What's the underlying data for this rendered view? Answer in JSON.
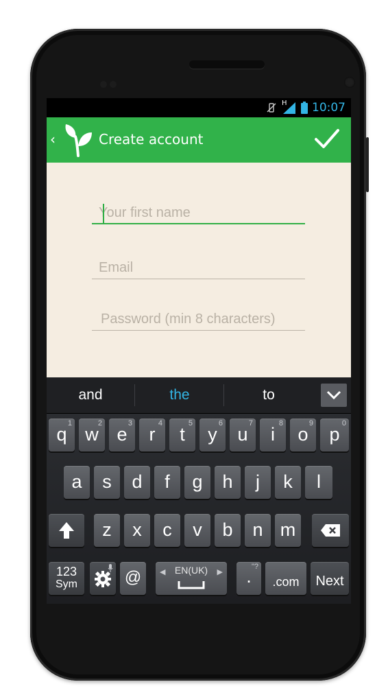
{
  "status_bar": {
    "time": "10:07",
    "icons": [
      "vibrate-muted-icon",
      "signal-icon",
      "battery-icon"
    ],
    "network_letter": "H"
  },
  "action_bar": {
    "title": "Create account",
    "up_icon": "‹",
    "logo": "leaf-logo-icon",
    "action_icon": "check-icon",
    "color": "#31b24a"
  },
  "form": {
    "first_name": {
      "placeholder": "Your first name",
      "value": ""
    },
    "email": {
      "placeholder": "Email",
      "value": ""
    },
    "password": {
      "placeholder": "Password (min 8 characters)",
      "value": ""
    }
  },
  "keyboard": {
    "suggestions": [
      "and",
      "the",
      "to"
    ],
    "row1": [
      {
        "key": "q",
        "hint": "1"
      },
      {
        "key": "w",
        "hint": "2"
      },
      {
        "key": "e",
        "hint": "3"
      },
      {
        "key": "r",
        "hint": "4"
      },
      {
        "key": "t",
        "hint": "5"
      },
      {
        "key": "y",
        "hint": "6"
      },
      {
        "key": "u",
        "hint": "7"
      },
      {
        "key": "i",
        "hint": "8"
      },
      {
        "key": "o",
        "hint": "9"
      },
      {
        "key": "p",
        "hint": "0"
      }
    ],
    "row2": [
      "a",
      "s",
      "d",
      "f",
      "g",
      "h",
      "j",
      "k",
      "l"
    ],
    "row3": [
      "z",
      "x",
      "c",
      "v",
      "b",
      "n",
      "m"
    ],
    "sym_label_1": "123",
    "sym_label_2": "Sym",
    "at_label": "@",
    "space_label": "EN(UK)",
    "period_label": ".",
    "period_hint": "\"?",
    "com_label": ".com",
    "next_label": "Next"
  }
}
